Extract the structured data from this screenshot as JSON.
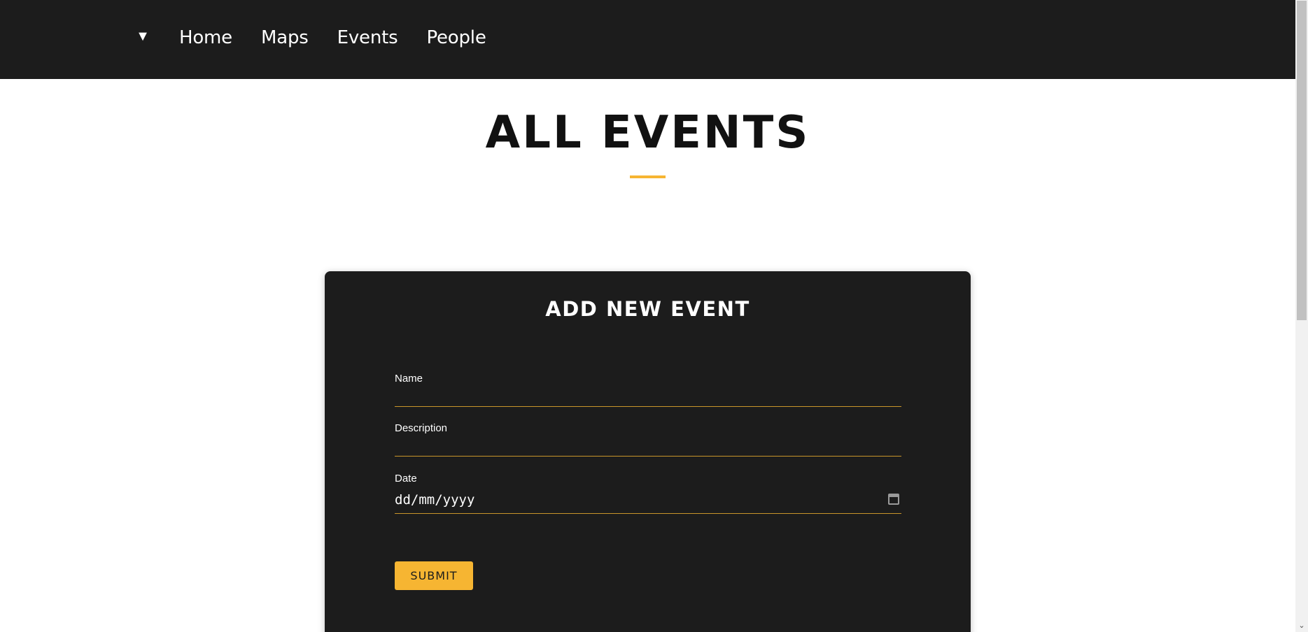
{
  "nav": {
    "toggle_glyph": "▼",
    "links": [
      "Home",
      "Maps",
      "Events",
      "People"
    ]
  },
  "page": {
    "title": "ALL EVENTS"
  },
  "form": {
    "title": "ADD NEW EVENT",
    "name_label": "Name",
    "name_value": "",
    "description_label": "Description",
    "description_value": "",
    "date_label": "Date",
    "date_placeholder": "dd/mm/yyyy",
    "submit_label": "SUBMIT"
  },
  "scrollbar": {
    "down_glyph": "⌄"
  },
  "colors": {
    "navbar_bg": "#1c1c1c",
    "accent": "#f6b532",
    "card_bg": "#1c1c1c",
    "page_bg": "#ffffff"
  },
  "icons": {
    "toggle": "caret-down-icon",
    "date": "calendar-icon"
  }
}
